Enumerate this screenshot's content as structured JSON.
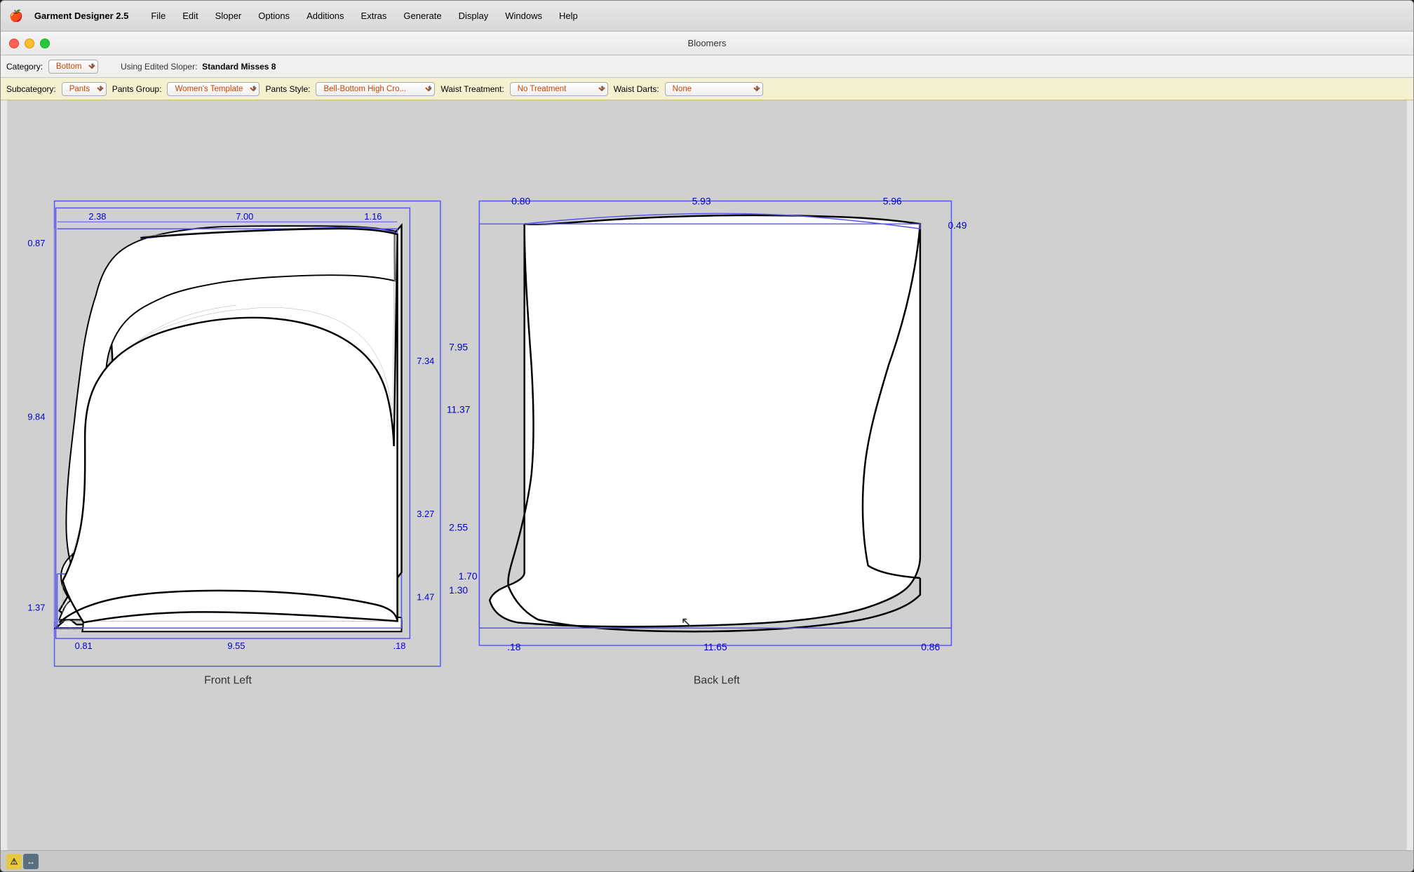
{
  "app": {
    "name": "Garment Designer 2.5",
    "title": "Bloomers"
  },
  "menubar": {
    "apple": "🍎",
    "items": [
      "File",
      "Edit",
      "Sloper",
      "Options",
      "Additions",
      "Extras",
      "Generate",
      "Display",
      "Windows",
      "Help"
    ]
  },
  "toolbar1": {
    "category_label": "Category:",
    "category_value": "Bottom",
    "sloper_label": "Using Edited Sloper:",
    "sloper_value": "Standard Misses 8"
  },
  "toolbar2": {
    "subcategory_label": "Subcategory:",
    "subcategory_value": "Pants",
    "pants_group_label": "Pants Group:",
    "pants_group_value": "Women's Template",
    "pants_style_label": "Pants Style:",
    "pants_style_value": "Bell-Bottom High Cro...",
    "waist_treatment_label": "Waist Treatment:",
    "waist_treatment_value": "No Treatment",
    "waist_darts_label": "Waist Darts:",
    "waist_darts_value": "None"
  },
  "patterns": {
    "front_left": {
      "label": "Front Left",
      "dims": {
        "top_left": "2.38",
        "top_center": "7.00",
        "top_right": "1.16",
        "left_top": "0.87",
        "left_mid": "9.84",
        "left_bot": "1.37",
        "right_top": "7.34",
        "right_mid": "3.27",
        "right_bot": "1.47",
        "bot_left": "0.81",
        "bot_center": "9.55",
        "bot_right": ".18"
      }
    },
    "back_left": {
      "label": "Back Left",
      "dims": {
        "top_left": "0.80",
        "top_center": "5.93",
        "top_right": "5.96",
        "top_far_right": "0.49",
        "left_top": "7.95",
        "left_mid": "11.37",
        "left_bot_mid": "2.55",
        "left_bot": "1.30",
        "left_far_bot": "1.70",
        "right_bot": "0.86",
        "bot_left": ".18",
        "bot_center": "11.65",
        "bot_right": "0.86"
      }
    }
  },
  "statusbar": {
    "icons": [
      "⚠",
      "↔"
    ]
  }
}
